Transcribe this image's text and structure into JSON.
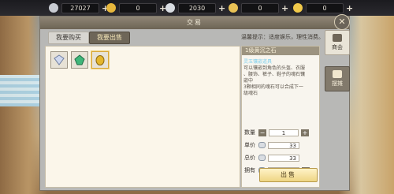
{
  "currencies": [
    {
      "name": "silver-ingot-icon",
      "amount": "27027",
      "color": "#c9ccd3"
    },
    {
      "name": "gold-ingot-icon",
      "amount": "0",
      "color": "#e7b73c"
    },
    {
      "name": "silver-bar-icon",
      "amount": "2030",
      "color": "#d9dde2"
    },
    {
      "name": "gold-bar-icon",
      "amount": "0",
      "color": "#e9c255"
    },
    {
      "name": "gold-coin-icon",
      "amount": "0",
      "color": "#f1c94a"
    }
  ],
  "dialog": {
    "title": "交易",
    "close_label": "✕",
    "tabs": [
      "我要购买",
      "我要出售"
    ],
    "active_tab": 1,
    "notice": "温馨提示：适度娱乐，理性消费。"
  },
  "items": [
    {
      "name": "diamond-gem-icon",
      "color": "#cfd8ee",
      "selected": false
    },
    {
      "name": "green-gem-icon",
      "color": "#3fb67a",
      "selected": false
    },
    {
      "name": "yellow-stone-icon",
      "color": "#e5b62c",
      "selected": true
    }
  ],
  "detail": {
    "title": "1级黄沉之石",
    "tag": "灵玉镶嵌道具",
    "desc_lines": [
      "可以镶嵌到角色的头盔、衣服",
      "、腰饰、裤子、鞋子的魂石镶",
      "嵌中",
      "3颗相同的魂石可以合成下一",
      "级魂石"
    ]
  },
  "form": {
    "qty_label": "数量",
    "qty": "1",
    "unit_label": "单价",
    "unit_price": "33",
    "total_label": "总价",
    "total_price": "33",
    "owned_label": "拥有",
    "owned": "2030",
    "sell_label": "出售"
  },
  "side_tabs": {
    "shop": "商会",
    "stall": "摆摊"
  },
  "accent": "#e9c255"
}
